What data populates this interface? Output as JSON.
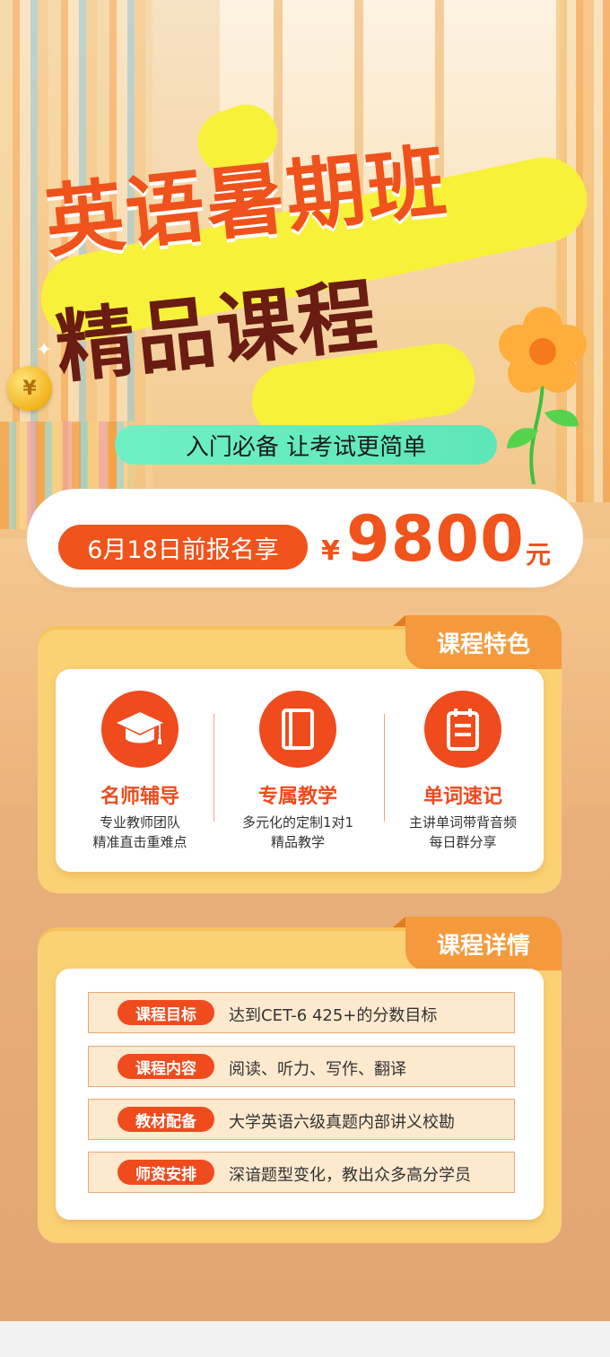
{
  "header": {
    "title_line1": "英语暑期班",
    "title_line2": "精品课程",
    "subtitle": "入门必备 让考试更简单"
  },
  "price": {
    "deadline_label": "6月18日前报名享",
    "currency": "¥",
    "amount": "9800",
    "unit": "元"
  },
  "features": {
    "tab": "课程特色",
    "items": [
      {
        "icon": "graduation-cap-icon",
        "title": "名师辅导",
        "desc1": "专业教师团队",
        "desc2": "精准直击重难点"
      },
      {
        "icon": "book-icon",
        "title": "专属教学",
        "desc1": "多元化的定制1对1",
        "desc2": "精品教学"
      },
      {
        "icon": "clipboard-icon",
        "title": "单词速记",
        "desc1": "主讲单词带背音频",
        "desc2": "每日群分享"
      }
    ]
  },
  "details": {
    "tab": "课程详情",
    "rows": [
      {
        "label": "课程目标",
        "text": "达到CET-6 425+的分数目标"
      },
      {
        "label": "课程内容",
        "text": "阅读、听力、写作、翻译"
      },
      {
        "label": "教材配备",
        "text": "大学英语六级真题内部讲义校勘"
      },
      {
        "label": "师资安排",
        "text": "深谙题型变化，教出众多高分学员"
      }
    ]
  },
  "decor": {
    "coin_symbol": "¥"
  },
  "colors": {
    "accent": "#ef4b1d",
    "title_dark": "#6a1c12",
    "highlight_yellow": "#f7f13a",
    "mint": "#6ff0c4",
    "card_yellow": "#fbd176",
    "tab_orange": "#f59a3c"
  }
}
